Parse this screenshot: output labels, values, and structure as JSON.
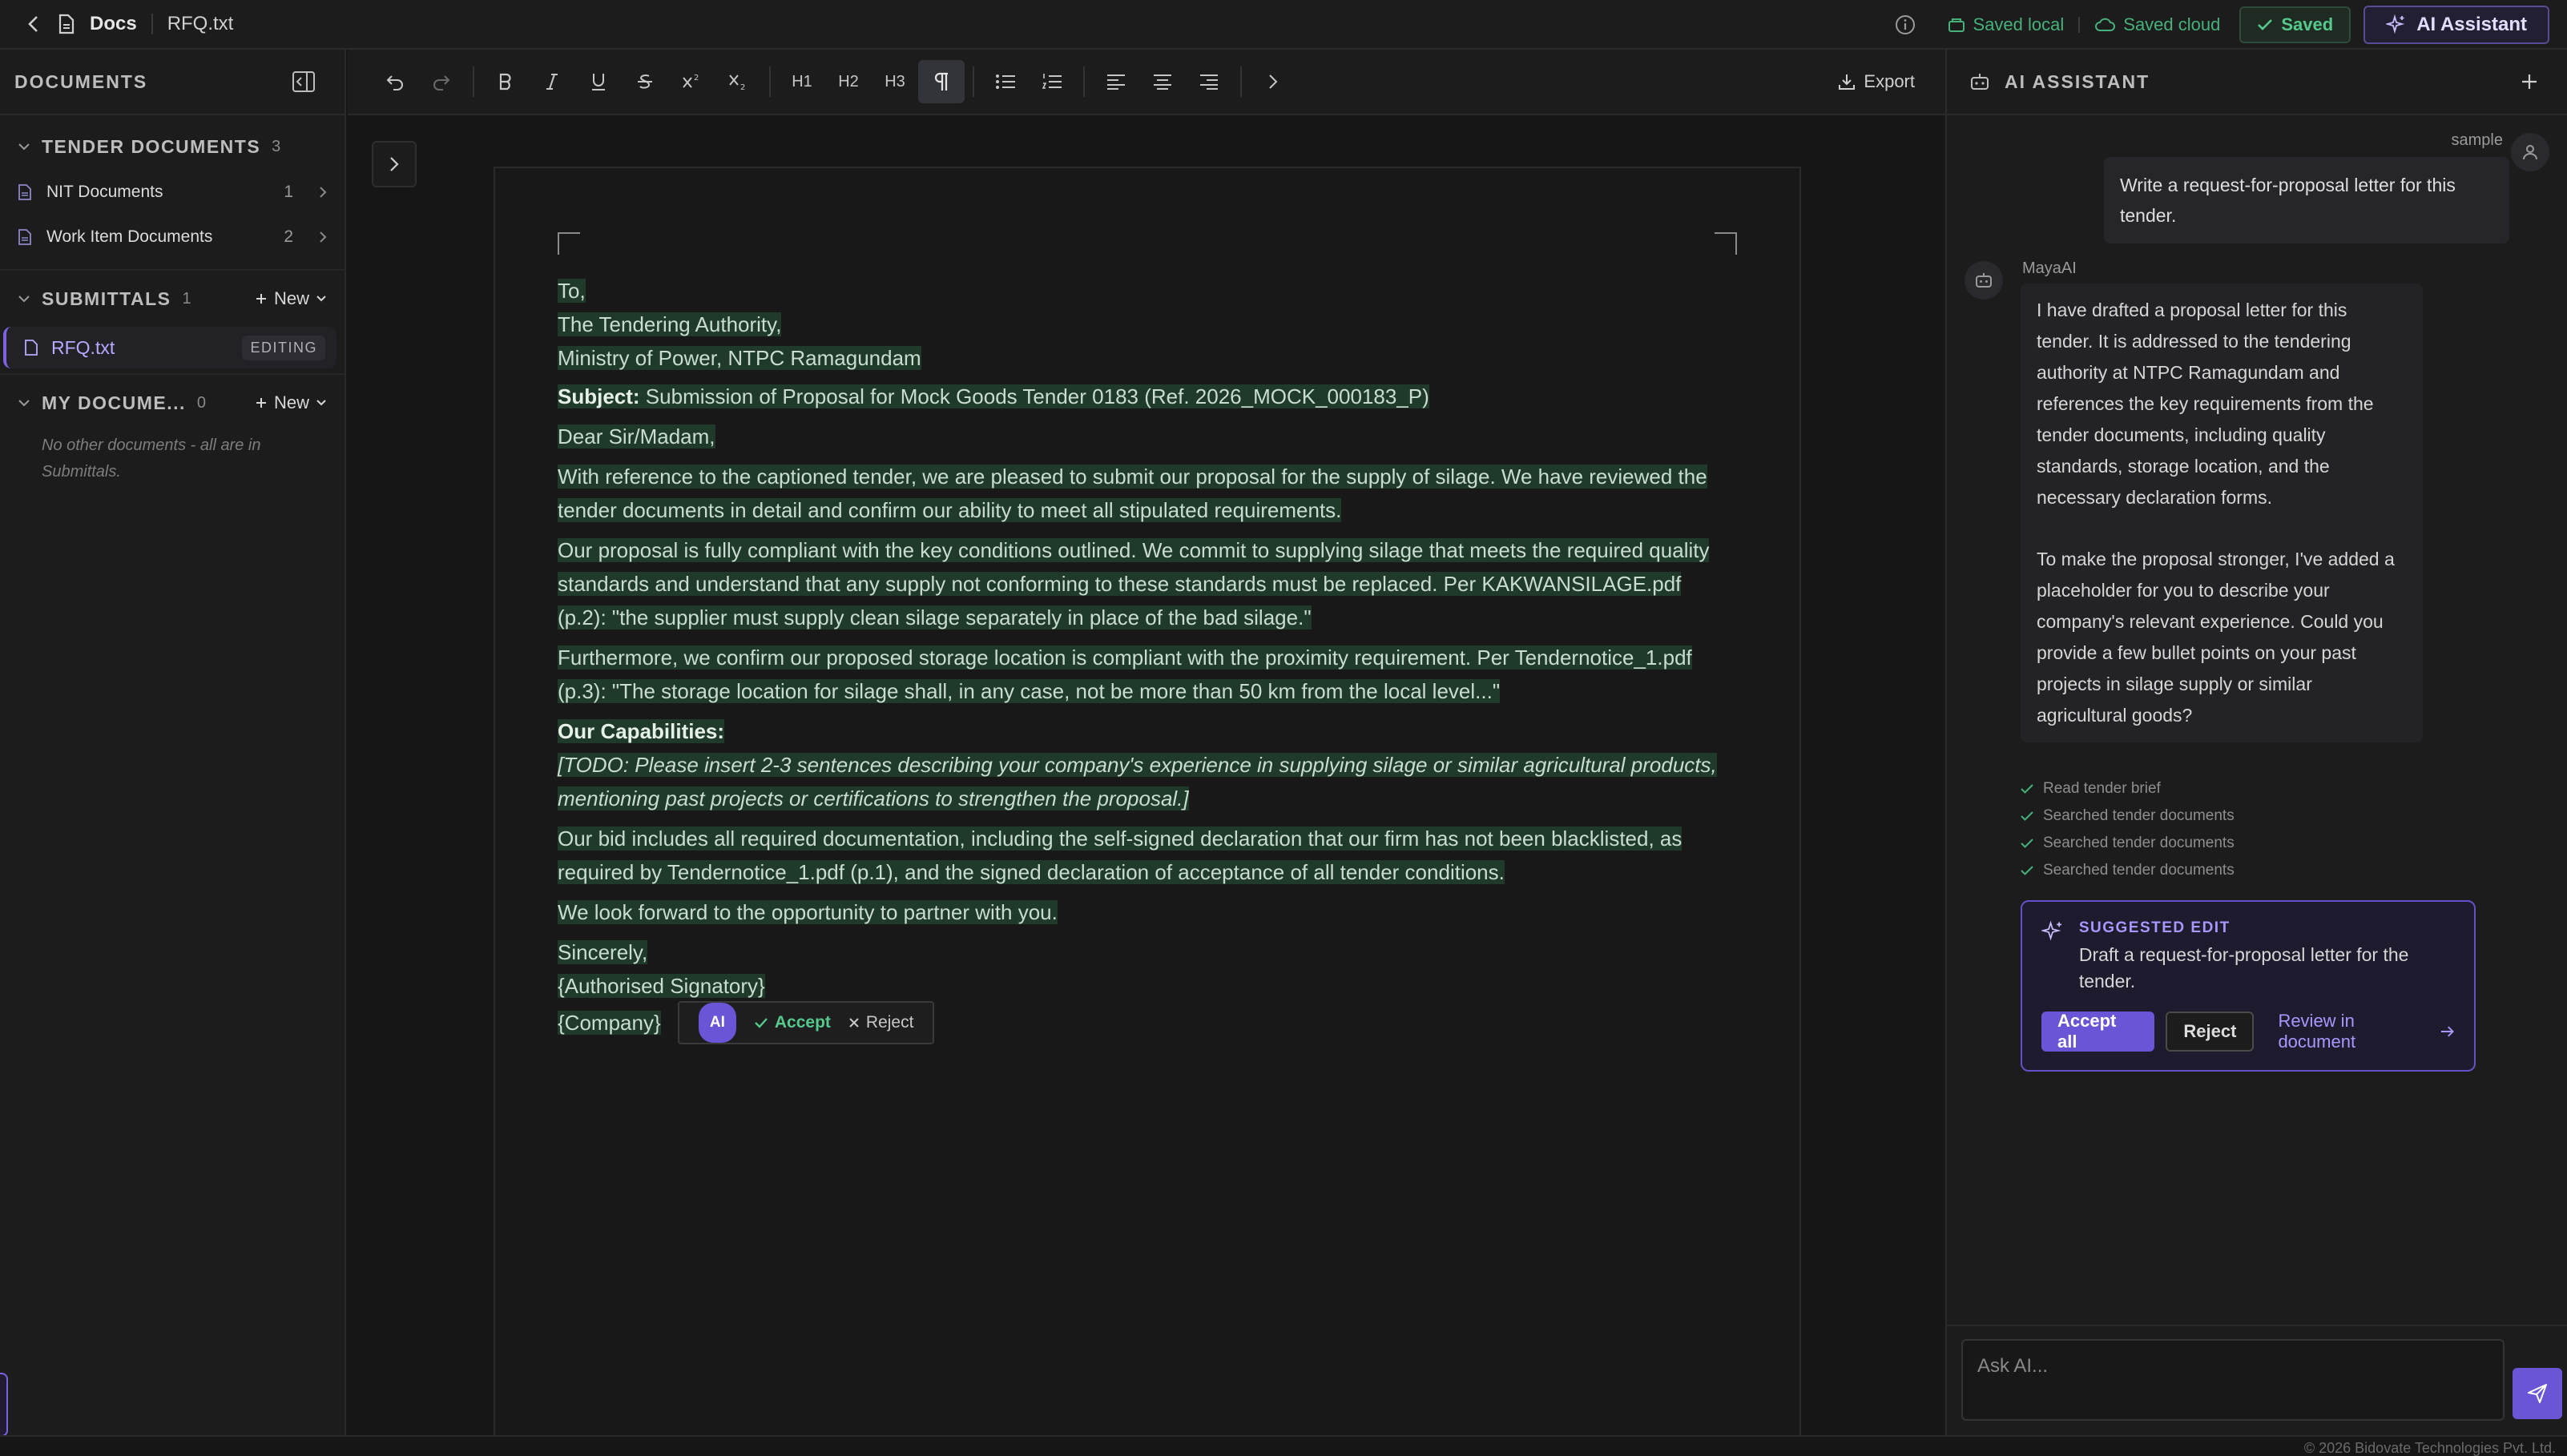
{
  "topbar": {
    "back_label": "Docs",
    "file_name": "RFQ.txt",
    "status_local": "Saved local",
    "status_cloud": "Saved cloud",
    "saved_label": "Saved",
    "ai_button_label": "AI Assistant"
  },
  "sidebar": {
    "title": "DOCUMENTS",
    "tender": {
      "title": "TENDER DOCUMENTS",
      "count": "3",
      "items": [
        {
          "label": "NIT Documents",
          "count": "1"
        },
        {
          "label": "Work Item Documents",
          "count": "2"
        }
      ]
    },
    "submittals": {
      "title": "SUBMITTALS",
      "count": "1",
      "new_label": "New",
      "active_file": "RFQ.txt",
      "active_badge": "EDITING"
    },
    "mydocs": {
      "title": "MY DOCUME...",
      "count": "0",
      "new_label": "New",
      "empty_note": "No other documents - all are in Submittals."
    }
  },
  "toolbar": {
    "tools": [
      "undo",
      "redo",
      "bold",
      "italic",
      "underline",
      "strikethrough",
      "superscript",
      "subscript",
      "H1",
      "H2",
      "H3",
      "paragraph",
      "bullet-list",
      "numbered-list",
      "align-left",
      "align-center",
      "align-right",
      "more"
    ],
    "h1": "H1",
    "h2": "H2",
    "h3": "H3",
    "export_label": "Export"
  },
  "document": {
    "to": "To,",
    "addressee": "The Tendering Authority,",
    "org": "Ministry of Power, NTPC Ramagundam",
    "subject_label": "Subject:",
    "subject_text": " Submission of Proposal for Mock Goods Tender 0183 (Ref. 2026_MOCK_000183_P)",
    "salutation": "Dear Sir/Madam,",
    "p1": "With reference to the captioned tender, we are pleased to submit our proposal for the supply of silage. We have reviewed the tender documents in detail and confirm our ability to meet all stipulated requirements.",
    "p2": "Our proposal is fully compliant with the key conditions outlined. We commit to supplying silage that meets the required quality standards and understand that any supply not conforming to these standards must be replaced. Per KAKWANSILAGE.pdf (p.2): \"the supplier must supply clean silage separately in place of the bad silage.\"",
    "p3": "Furthermore, we confirm our proposed storage location is compliant with the proximity requirement. Per Tendernotice_1.pdf (p.3): \"The storage location for silage shall, in any case, not be more than 50 km from the local level...\"",
    "capabilities_heading": "Our Capabilities:",
    "todo": "[TODO: Please insert 2-3 sentences describing your company's experience in supplying silage or similar agricultural products, mentioning past projects or certifications to strengthen the proposal.]",
    "p4": "Our bid includes all required documentation, including the self-signed declaration that our firm has not been blacklisted, as required by Tendernotice_1.pdf (p.1), and the signed declaration of acceptance of all tender conditions.",
    "p5": "We look forward to the opportunity to partner with you.",
    "closing": "Sincerely,",
    "signatory": "{Authorised Signatory}",
    "company": "{Company}",
    "popup": {
      "ai": "AI",
      "accept": "Accept",
      "reject": "Reject"
    }
  },
  "assistant": {
    "title": "AI ASSISTANT",
    "user_name": "sample",
    "user_message": "Write a request-for-proposal letter for this tender.",
    "bot_name": "MayaAI",
    "bot_message_1": "I have drafted a proposal letter for this tender. It is addressed to the tendering authority at NTPC Ramagundam and references the key requirements from the tender documents, including quality standards, storage location, and the necessary declaration forms.",
    "bot_message_2": "To make the proposal stronger, I've added a placeholder for you to describe your company's relevant experience. Could you provide a few bullet points on your past projects in silage supply or similar agricultural goods?",
    "steps": [
      "Read tender brief",
      "Searched tender documents",
      "Searched tender documents",
      "Searched tender documents"
    ],
    "suggestion": {
      "label": "SUGGESTED EDIT",
      "text": "Draft a request-for-proposal letter for the tender.",
      "accept_all": "Accept all",
      "reject": "Reject",
      "review": "Review in document"
    },
    "input_placeholder": "Ask AI..."
  },
  "footer": {
    "copyright": "© 2026 Bidovate Technologies Pvt. Ltd."
  },
  "colors": {
    "accent": "#6a55d6",
    "success": "#46b17a",
    "highlight": "#1f3a2b",
    "background": "#161616"
  }
}
